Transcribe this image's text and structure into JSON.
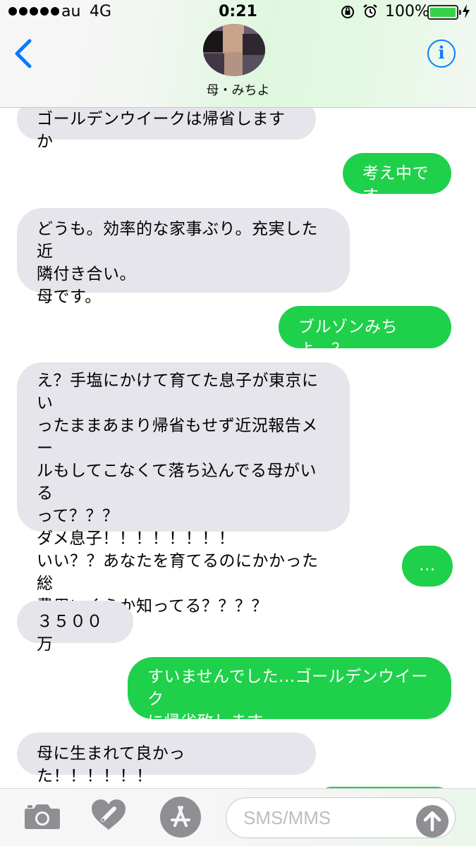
{
  "status_bar": {
    "carrier": "au",
    "network": "4G",
    "time": "0:21",
    "battery_percent": "100%",
    "battery_level": 1.0,
    "icons": [
      "signal-dots-icon",
      "rotation-lock-icon",
      "alarm-icon",
      "battery-icon",
      "charging-bolt-icon"
    ]
  },
  "nav": {
    "back_icon": "chevron-left-icon",
    "contact_name": "母・みちよ",
    "info_label": "i",
    "accent": "#0a7aff"
  },
  "messages": [
    {
      "side": "in",
      "text": "ゴールデンウイークは帰省しますか"
    },
    {
      "side": "out",
      "text": "考え中です"
    },
    {
      "side": "in",
      "text": "どうも。効率的な家事ぶり。充実した近\n隣付き合い。\n母です。"
    },
    {
      "side": "out",
      "text": "ブルゾンみちよ...？"
    },
    {
      "side": "in",
      "text": "え？手塩にかけて育てた息子が東京にい\nったままあまり帰省もせず近況報告メー\nルもしてこなくて落ち込んでる母がいる\nって？？？\nダメ息子！！！！！！！！\nいい？？あなたを育てるのにかかった総\n費用いくらか知ってる？？？？"
    },
    {
      "side": "out",
      "text": "..."
    },
    {
      "side": "in",
      "text": "３５００万"
    },
    {
      "side": "out",
      "text": "すいませんでした...ゴールデンウイーク\nに帰省致します..."
    },
    {
      "side": "in",
      "text": "母に生まれて良かった！！！！！！"
    }
  ],
  "colors": {
    "incoming_bubble": "#e6e5eb",
    "outgoing_bubble": "#1fd04b",
    "send_button": "#8e8e93"
  },
  "compose": {
    "placeholder": "SMS/MMS",
    "icons": [
      "camera-icon",
      "digital-touch-heart-icon",
      "app-store-icon",
      "send-arrow-icon"
    ]
  }
}
